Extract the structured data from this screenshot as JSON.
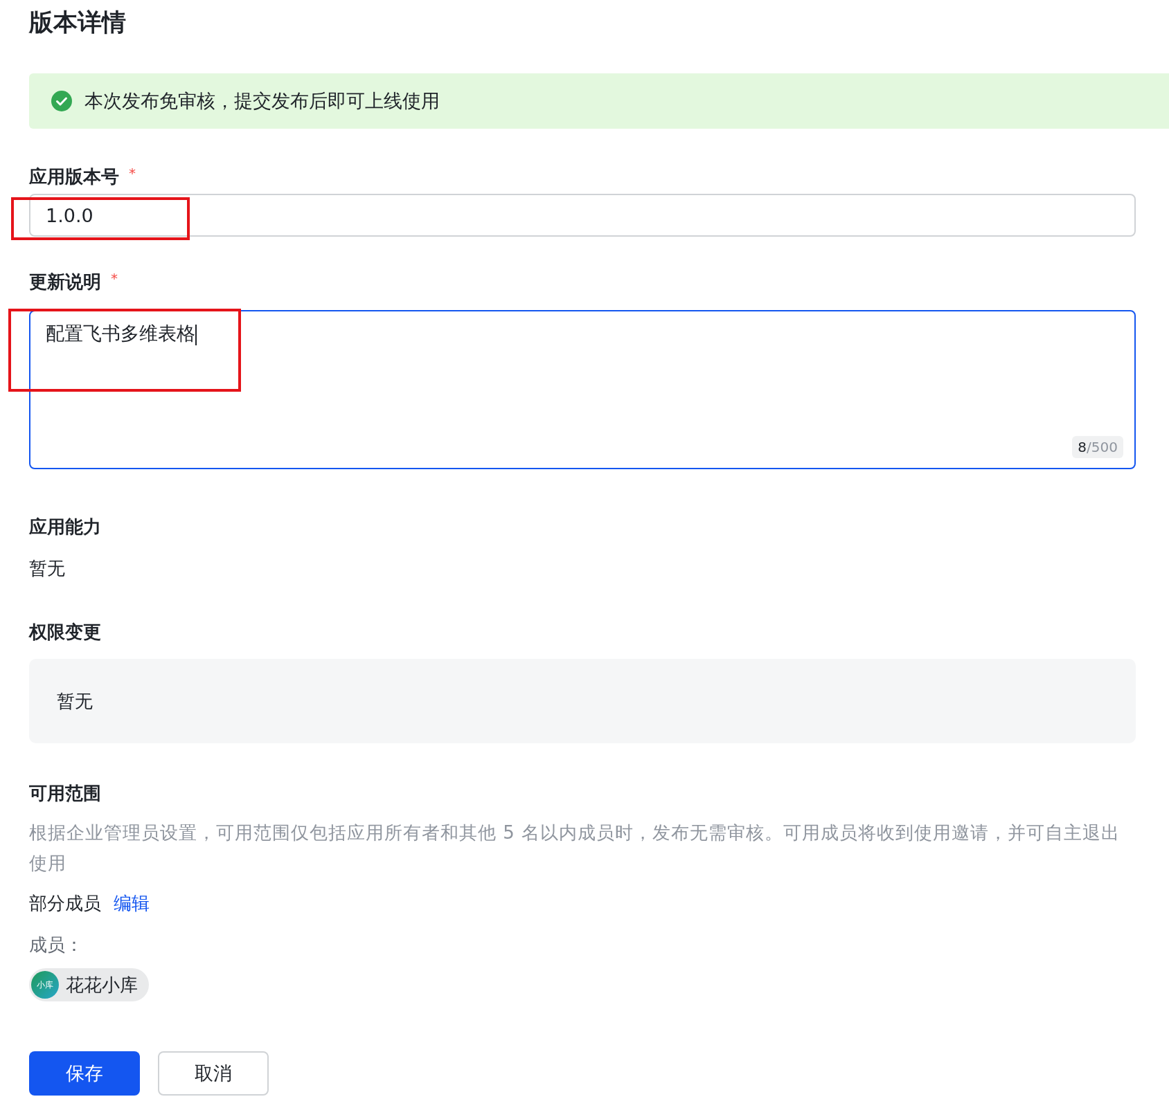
{
  "title": "版本详情",
  "notice": {
    "kind": "success",
    "text": "本次发布免审核，提交发布后即可上线使用"
  },
  "version_field": {
    "label": "应用版本号",
    "required_mark": "*",
    "value": "1.0.0",
    "highlighted": true
  },
  "notes_field": {
    "label": "更新说明",
    "required_mark": "*",
    "value": "配置飞书多维表格",
    "focused": true,
    "counter_current": "8",
    "counter_max": "/500",
    "highlighted": true
  },
  "capabilities": {
    "label": "应用能力",
    "value": "暂无"
  },
  "permissions": {
    "label": "权限变更",
    "value": "暂无"
  },
  "scope": {
    "label": "可用范围",
    "description": "根据企业管理员设置，可用范围仅包括应用所有者和其他 5 名以内成员时，发布无需审核。可用成员将收到使用邀请，并可自主退出使用",
    "mode": "部分成员",
    "edit_link": "编辑",
    "members_label": "成员：",
    "members": [
      {
        "avatar_text": "小库",
        "name": "花花小库"
      }
    ]
  },
  "buttons": [
    {
      "label": "保存",
      "kind": "primary"
    },
    {
      "label": "取消",
      "kind": "secondary"
    }
  ]
}
